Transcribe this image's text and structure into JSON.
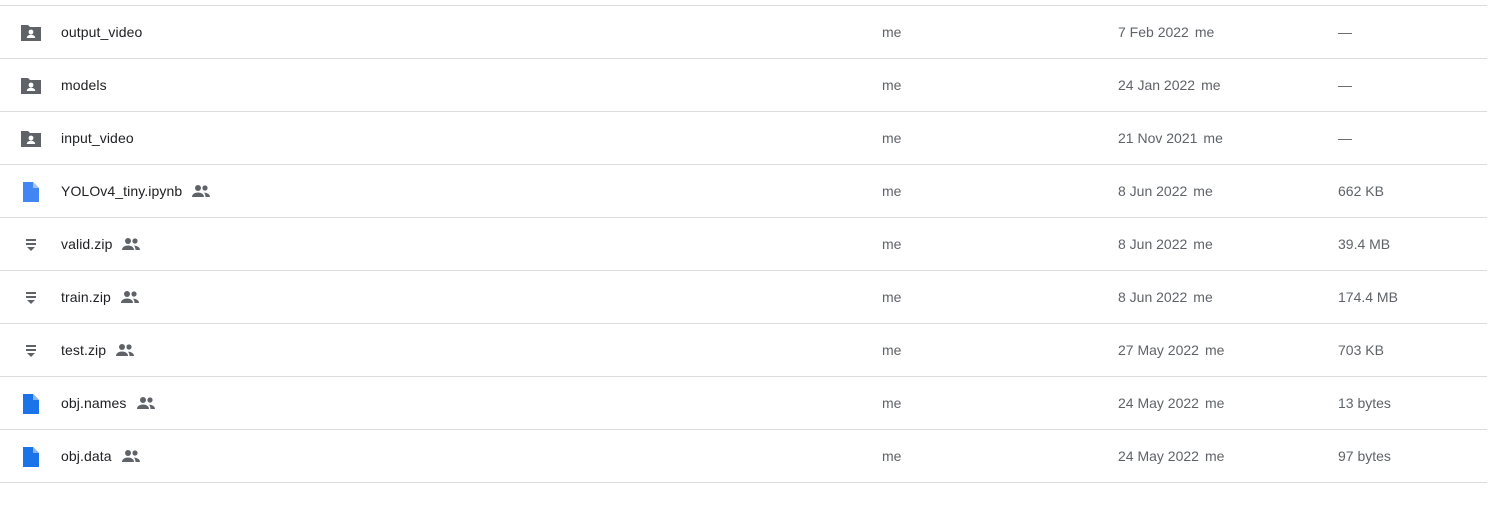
{
  "colors": {
    "folder": "#5f6368",
    "doc_blue": "#4285f4",
    "file_blue": "#1a73e8",
    "zip_gray": "#5f6368",
    "divider": "#dadce0",
    "text_primary": "#202124",
    "text_secondary": "#5f6368"
  },
  "files": [
    {
      "icon": "shared-folder-icon",
      "name": "output_video",
      "shared": false,
      "owner": "me",
      "modified_date": "7 Feb 2022",
      "modified_by": "me",
      "size": "—"
    },
    {
      "icon": "shared-folder-icon",
      "name": "models",
      "shared": false,
      "owner": "me",
      "modified_date": "24 Jan 2022",
      "modified_by": "me",
      "size": "—"
    },
    {
      "icon": "shared-folder-icon",
      "name": "input_video",
      "shared": false,
      "owner": "me",
      "modified_date": "21 Nov 2021",
      "modified_by": "me",
      "size": "—"
    },
    {
      "icon": "notebook-file-icon",
      "name": "YOLOv4_tiny.ipynb",
      "shared": true,
      "owner": "me",
      "modified_date": "8 Jun 2022",
      "modified_by": "me",
      "size": "662 KB"
    },
    {
      "icon": "zip-file-icon",
      "name": "valid.zip",
      "shared": true,
      "owner": "me",
      "modified_date": "8 Jun 2022",
      "modified_by": "me",
      "size": "39.4 MB"
    },
    {
      "icon": "zip-file-icon",
      "name": "train.zip",
      "shared": true,
      "owner": "me",
      "modified_date": "8 Jun 2022",
      "modified_by": "me",
      "size": "174.4 MB"
    },
    {
      "icon": "zip-file-icon",
      "name": "test.zip",
      "shared": true,
      "owner": "me",
      "modified_date": "27 May 2022",
      "modified_by": "me",
      "size": "703 KB"
    },
    {
      "icon": "text-file-icon",
      "name": "obj.names",
      "shared": true,
      "owner": "me",
      "modified_date": "24 May 2022",
      "modified_by": "me",
      "size": "13 bytes"
    },
    {
      "icon": "text-file-icon",
      "name": "obj.data",
      "shared": true,
      "owner": "me",
      "modified_date": "24 May 2022",
      "modified_by": "me",
      "size": "97 bytes"
    }
  ]
}
